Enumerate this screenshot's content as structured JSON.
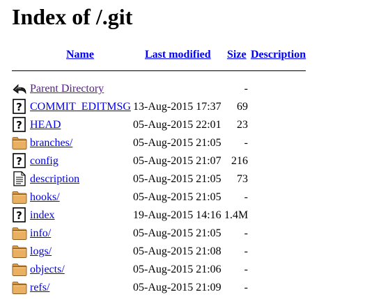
{
  "page": {
    "title": "Index of /.git"
  },
  "columns": {
    "name": "Name",
    "last_modified": "Last modified",
    "size": "Size",
    "description": "Description"
  },
  "rows": [
    {
      "icon": "back-arrow-icon",
      "name": "Parent Directory",
      "date": "",
      "size": "-",
      "description": ""
    },
    {
      "icon": "unknown-file-icon",
      "name": "COMMIT_EDITMSG",
      "date": "13-Aug-2015 17:37",
      "size": "69",
      "description": ""
    },
    {
      "icon": "unknown-file-icon",
      "name": "HEAD",
      "date": "05-Aug-2015 22:01",
      "size": "23",
      "description": ""
    },
    {
      "icon": "folder-icon",
      "name": "branches/",
      "date": "05-Aug-2015 21:05",
      "size": "-",
      "description": ""
    },
    {
      "icon": "unknown-file-icon",
      "name": "config",
      "date": "05-Aug-2015 21:07",
      "size": "216",
      "description": ""
    },
    {
      "icon": "text-file-icon",
      "name": "description",
      "date": "05-Aug-2015 21:05",
      "size": "73",
      "description": ""
    },
    {
      "icon": "folder-icon",
      "name": "hooks/",
      "date": "05-Aug-2015 21:05",
      "size": "-",
      "description": ""
    },
    {
      "icon": "unknown-file-icon",
      "name": "index",
      "date": "19-Aug-2015 14:16",
      "size": "1.4M",
      "description": ""
    },
    {
      "icon": "folder-icon",
      "name": "info/",
      "date": "05-Aug-2015 21:05",
      "size": "-",
      "description": ""
    },
    {
      "icon": "folder-icon",
      "name": "logs/",
      "date": "05-Aug-2015 21:08",
      "size": "-",
      "description": ""
    },
    {
      "icon": "folder-icon",
      "name": "objects/",
      "date": "05-Aug-2015 21:06",
      "size": "-",
      "description": ""
    },
    {
      "icon": "folder-icon",
      "name": "refs/",
      "date": "05-Aug-2015 21:09",
      "size": "-",
      "description": ""
    }
  ],
  "colors": {
    "link": "#0000ee",
    "visited_link": "#551a8b",
    "folder": "#e8b060"
  }
}
